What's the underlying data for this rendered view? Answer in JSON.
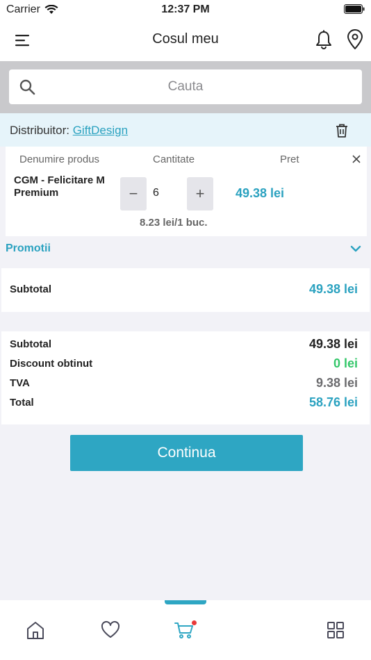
{
  "status_bar": {
    "carrier": "Carrier",
    "time": "12:37 PM"
  },
  "header": {
    "title": "Cosul meu",
    "icons": [
      "menu-icon",
      "bell-icon",
      "location-pin-icon"
    ]
  },
  "search": {
    "placeholder": "Cauta",
    "value": ""
  },
  "distributor": {
    "label": "Distribuitor:",
    "name": "GiftDesign"
  },
  "cart_table": {
    "headers": {
      "name": "Denumire produs",
      "quantity": "Cantitate",
      "price": "Pret"
    },
    "items": [
      {
        "name": "CGM - Felicitare M Premium",
        "quantity": "6",
        "price": "49.38 lei",
        "unit_price": "8.23 lei/1 buc."
      }
    ]
  },
  "promotions": {
    "label": "Promotii"
  },
  "subtotal_section": {
    "label": "Subtotal",
    "value": "49.38 lei"
  },
  "summary": {
    "rows": [
      {
        "label": "Subtotal",
        "value": "49.38 lei"
      },
      {
        "label": "Discount obtinut",
        "value": "0 lei"
      },
      {
        "label": "TVA",
        "value": "9.38 lei"
      },
      {
        "label": "Total",
        "value": "58.76 lei"
      }
    ]
  },
  "actions": {
    "continue_label": "Continua"
  },
  "tab_bar": {
    "items": [
      "home-icon",
      "heart-icon",
      "cart-icon",
      "grid-icon"
    ],
    "active": "cart-icon"
  },
  "colors": {
    "accent": "#2ea6c3",
    "discount_green": "#34c76a",
    "distributor_bg": "#e6f4fa",
    "badge_red": "#e83a3a"
  }
}
